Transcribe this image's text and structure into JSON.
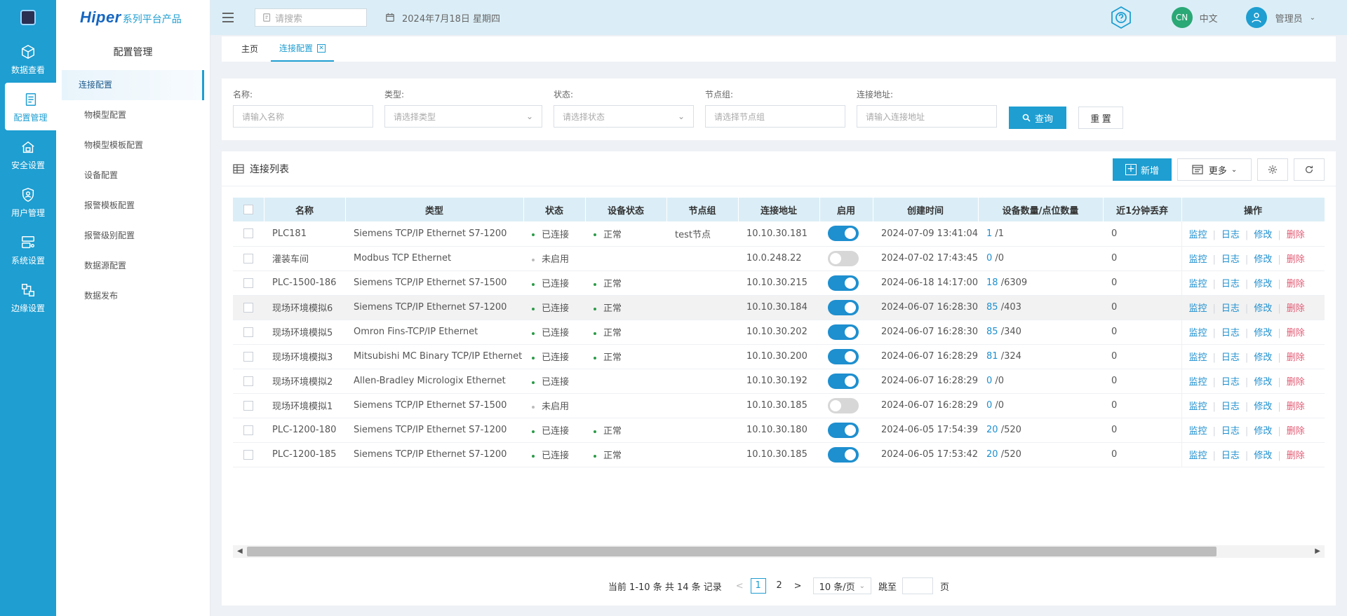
{
  "colors": {
    "primary": "#1e9ed1",
    "success": "#2b9b48",
    "danger": "#e35b74"
  },
  "rail": {
    "items": [
      {
        "label": "数据查看",
        "icon": "cube-icon"
      },
      {
        "label": "配置管理",
        "icon": "config-icon"
      },
      {
        "label": "安全设置",
        "icon": "home-lock-icon"
      },
      {
        "label": "用户管理",
        "icon": "shield-user-icon"
      },
      {
        "label": "系统设置",
        "icon": "server-settings-icon"
      },
      {
        "label": "边缘设置",
        "icon": "edge-network-icon"
      }
    ]
  },
  "brand": {
    "name": "Hiper",
    "suffix": "系列平台产品"
  },
  "sidebar": {
    "title": "配置管理",
    "items": [
      {
        "label": "连接配置"
      },
      {
        "label": "物模型配置"
      },
      {
        "label": "物模型模板配置"
      },
      {
        "label": "设备配置"
      },
      {
        "label": "报警模板配置"
      },
      {
        "label": "报警级别配置"
      },
      {
        "label": "数据源配置"
      },
      {
        "label": "数据发布"
      }
    ]
  },
  "header": {
    "search_placeholder": "请搜索",
    "date": "2024年7月18日 星期四",
    "lang_badge": "CN",
    "lang_label": "中文",
    "user": "管理员"
  },
  "tabs": [
    {
      "label": "主页"
    },
    {
      "label": "连接配置"
    }
  ],
  "filters": {
    "name": {
      "label": "名称:",
      "placeholder": "请输入名称"
    },
    "type": {
      "label": "类型:",
      "placeholder": "请选择类型"
    },
    "status": {
      "label": "状态:",
      "placeholder": "请选择状态"
    },
    "group": {
      "label": "节点组:",
      "placeholder": "请选择节点组"
    },
    "address": {
      "label": "连接地址:",
      "placeholder": "请输入连接地址"
    },
    "query_label": "查询",
    "reset_label": "重 置"
  },
  "panel": {
    "title": "连接列表",
    "add_label": "新增",
    "more_label": "更多"
  },
  "table": {
    "columns": [
      "名称",
      "类型",
      "状态",
      "设备状态",
      "节点组",
      "连接地址",
      "启用",
      "创建时间",
      "设备数量/点位数量",
      "近1分钟丢弃",
      "操作"
    ],
    "ops": {
      "monitor": "监控",
      "log": "日志",
      "edit": "修改",
      "delete": "删除"
    },
    "rows": [
      {
        "name": "PLC181",
        "type": "Siemens TCP/IP Ethernet S7-1200",
        "status": "已连接",
        "device_status": "正常",
        "group": "test节点",
        "address": "10.10.30.181",
        "enabled": true,
        "created": "2024-07-09 13:41:04",
        "devices": "1",
        "points": "/1",
        "dropped": "0"
      },
      {
        "name": "灌装车间",
        "type": "Modbus TCP Ethernet",
        "status": "未启用",
        "device_status": "",
        "group": "",
        "address": "10.0.248.22",
        "enabled": false,
        "created": "2024-07-02 17:43:45",
        "devices": "0",
        "points": "/0",
        "dropped": "0"
      },
      {
        "name": "PLC-1500-186",
        "type": "Siemens TCP/IP Ethernet S7-1500",
        "status": "已连接",
        "device_status": "正常",
        "group": "",
        "address": "10.10.30.215",
        "enabled": true,
        "created": "2024-06-18 14:17:00",
        "devices": "18",
        "points": "/6309",
        "dropped": "0"
      },
      {
        "name": "现场环境模拟6",
        "type": "Siemens TCP/IP Ethernet S7-1200",
        "status": "已连接",
        "device_status": "正常",
        "group": "",
        "address": "10.10.30.184",
        "enabled": true,
        "created": "2024-06-07 16:28:30",
        "devices": "85",
        "points": "/403",
        "dropped": "0"
      },
      {
        "name": "现场环境模拟5",
        "type": "Omron Fins-TCP/IP Ethernet",
        "status": "已连接",
        "device_status": "正常",
        "group": "",
        "address": "10.10.30.202",
        "enabled": true,
        "created": "2024-06-07 16:28:30",
        "devices": "85",
        "points": "/340",
        "dropped": "0"
      },
      {
        "name": "现场环境模拟3",
        "type": "Mitsubishi MC Binary TCP/IP Ethernet",
        "status": "已连接",
        "device_status": "正常",
        "group": "",
        "address": "10.10.30.200",
        "enabled": true,
        "created": "2024-06-07 16:28:29",
        "devices": "81",
        "points": "/324",
        "dropped": "0"
      },
      {
        "name": "现场环境模拟2",
        "type": "Allen-Bradley Micrologix Ethernet",
        "status": "已连接",
        "device_status": "",
        "group": "",
        "address": "10.10.30.192",
        "enabled": true,
        "created": "2024-06-07 16:28:29",
        "devices": "0",
        "points": "/0",
        "dropped": "0"
      },
      {
        "name": "现场环境模拟1",
        "type": "Siemens TCP/IP Ethernet S7-1500",
        "status": "未启用",
        "device_status": "",
        "group": "",
        "address": "10.10.30.185",
        "enabled": false,
        "created": "2024-06-07 16:28:29",
        "devices": "0",
        "points": "/0",
        "dropped": "0"
      },
      {
        "name": "PLC-1200-180",
        "type": "Siemens TCP/IP Ethernet S7-1200",
        "status": "已连接",
        "device_status": "正常",
        "group": "",
        "address": "10.10.30.180",
        "enabled": true,
        "created": "2024-06-05 17:54:39",
        "devices": "20",
        "points": "/520",
        "dropped": "0"
      },
      {
        "name": "PLC-1200-185",
        "type": "Siemens TCP/IP Ethernet S7-1200",
        "status": "已连接",
        "device_status": "正常",
        "group": "",
        "address": "10.10.30.185",
        "enabled": true,
        "created": "2024-06-05 17:53:42",
        "devices": "20",
        "points": "/520",
        "dropped": "0"
      }
    ]
  },
  "pagination": {
    "summary": "当前 1-10 条 共 14 条 记录",
    "pages": [
      "1",
      "2"
    ],
    "current": "1",
    "page_size": "10 条/页",
    "jump_label": "跳至",
    "page_unit": "页"
  }
}
